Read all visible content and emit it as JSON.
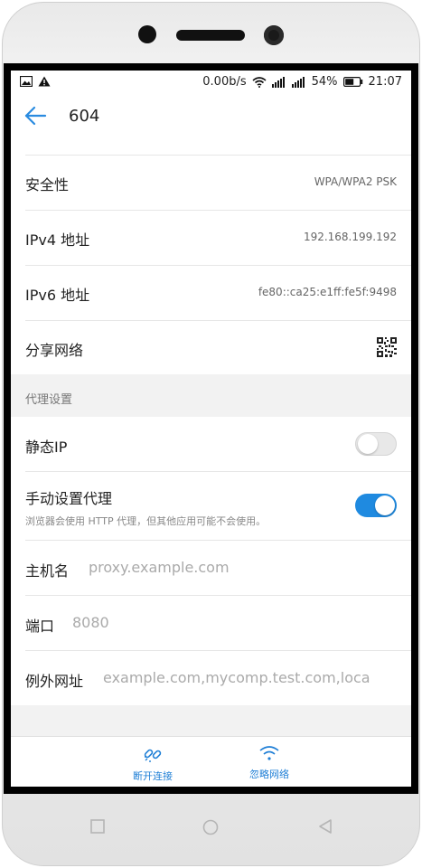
{
  "status_bar": {
    "speed": "0.00b/s",
    "battery": "54%",
    "time": "21:07"
  },
  "header": {
    "title": "604"
  },
  "details": [
    {
      "label": "安全性",
      "value": "WPA/WPA2 PSK"
    },
    {
      "label": "IPv4 地址",
      "value": "192.168.199.192"
    },
    {
      "label": "IPv6 地址",
      "value": "fe80::ca25:e1ff:fe5f:9498"
    },
    {
      "label": "分享网络",
      "icon": "qr-code-icon"
    }
  ],
  "proxy_section": {
    "title": "代理设置",
    "static_ip": {
      "label": "静态IP",
      "enabled": false
    },
    "manual_proxy": {
      "label": "手动设置代理",
      "hint": "浏览器会使用 HTTP 代理，但其他应用可能不会使用。",
      "enabled": true
    },
    "host": {
      "label": "主机名",
      "placeholder": "proxy.example.com"
    },
    "port": {
      "label": "端口",
      "placeholder": "8080"
    },
    "exclusions": {
      "label": "例外网址",
      "placeholder": "example.com,mycomp.test.com,loca"
    }
  },
  "actions": {
    "disconnect": "断开连接",
    "forget": "忽略网络"
  },
  "colors": {
    "accent": "#1f8ae0",
    "background": "#f2f2f2"
  }
}
